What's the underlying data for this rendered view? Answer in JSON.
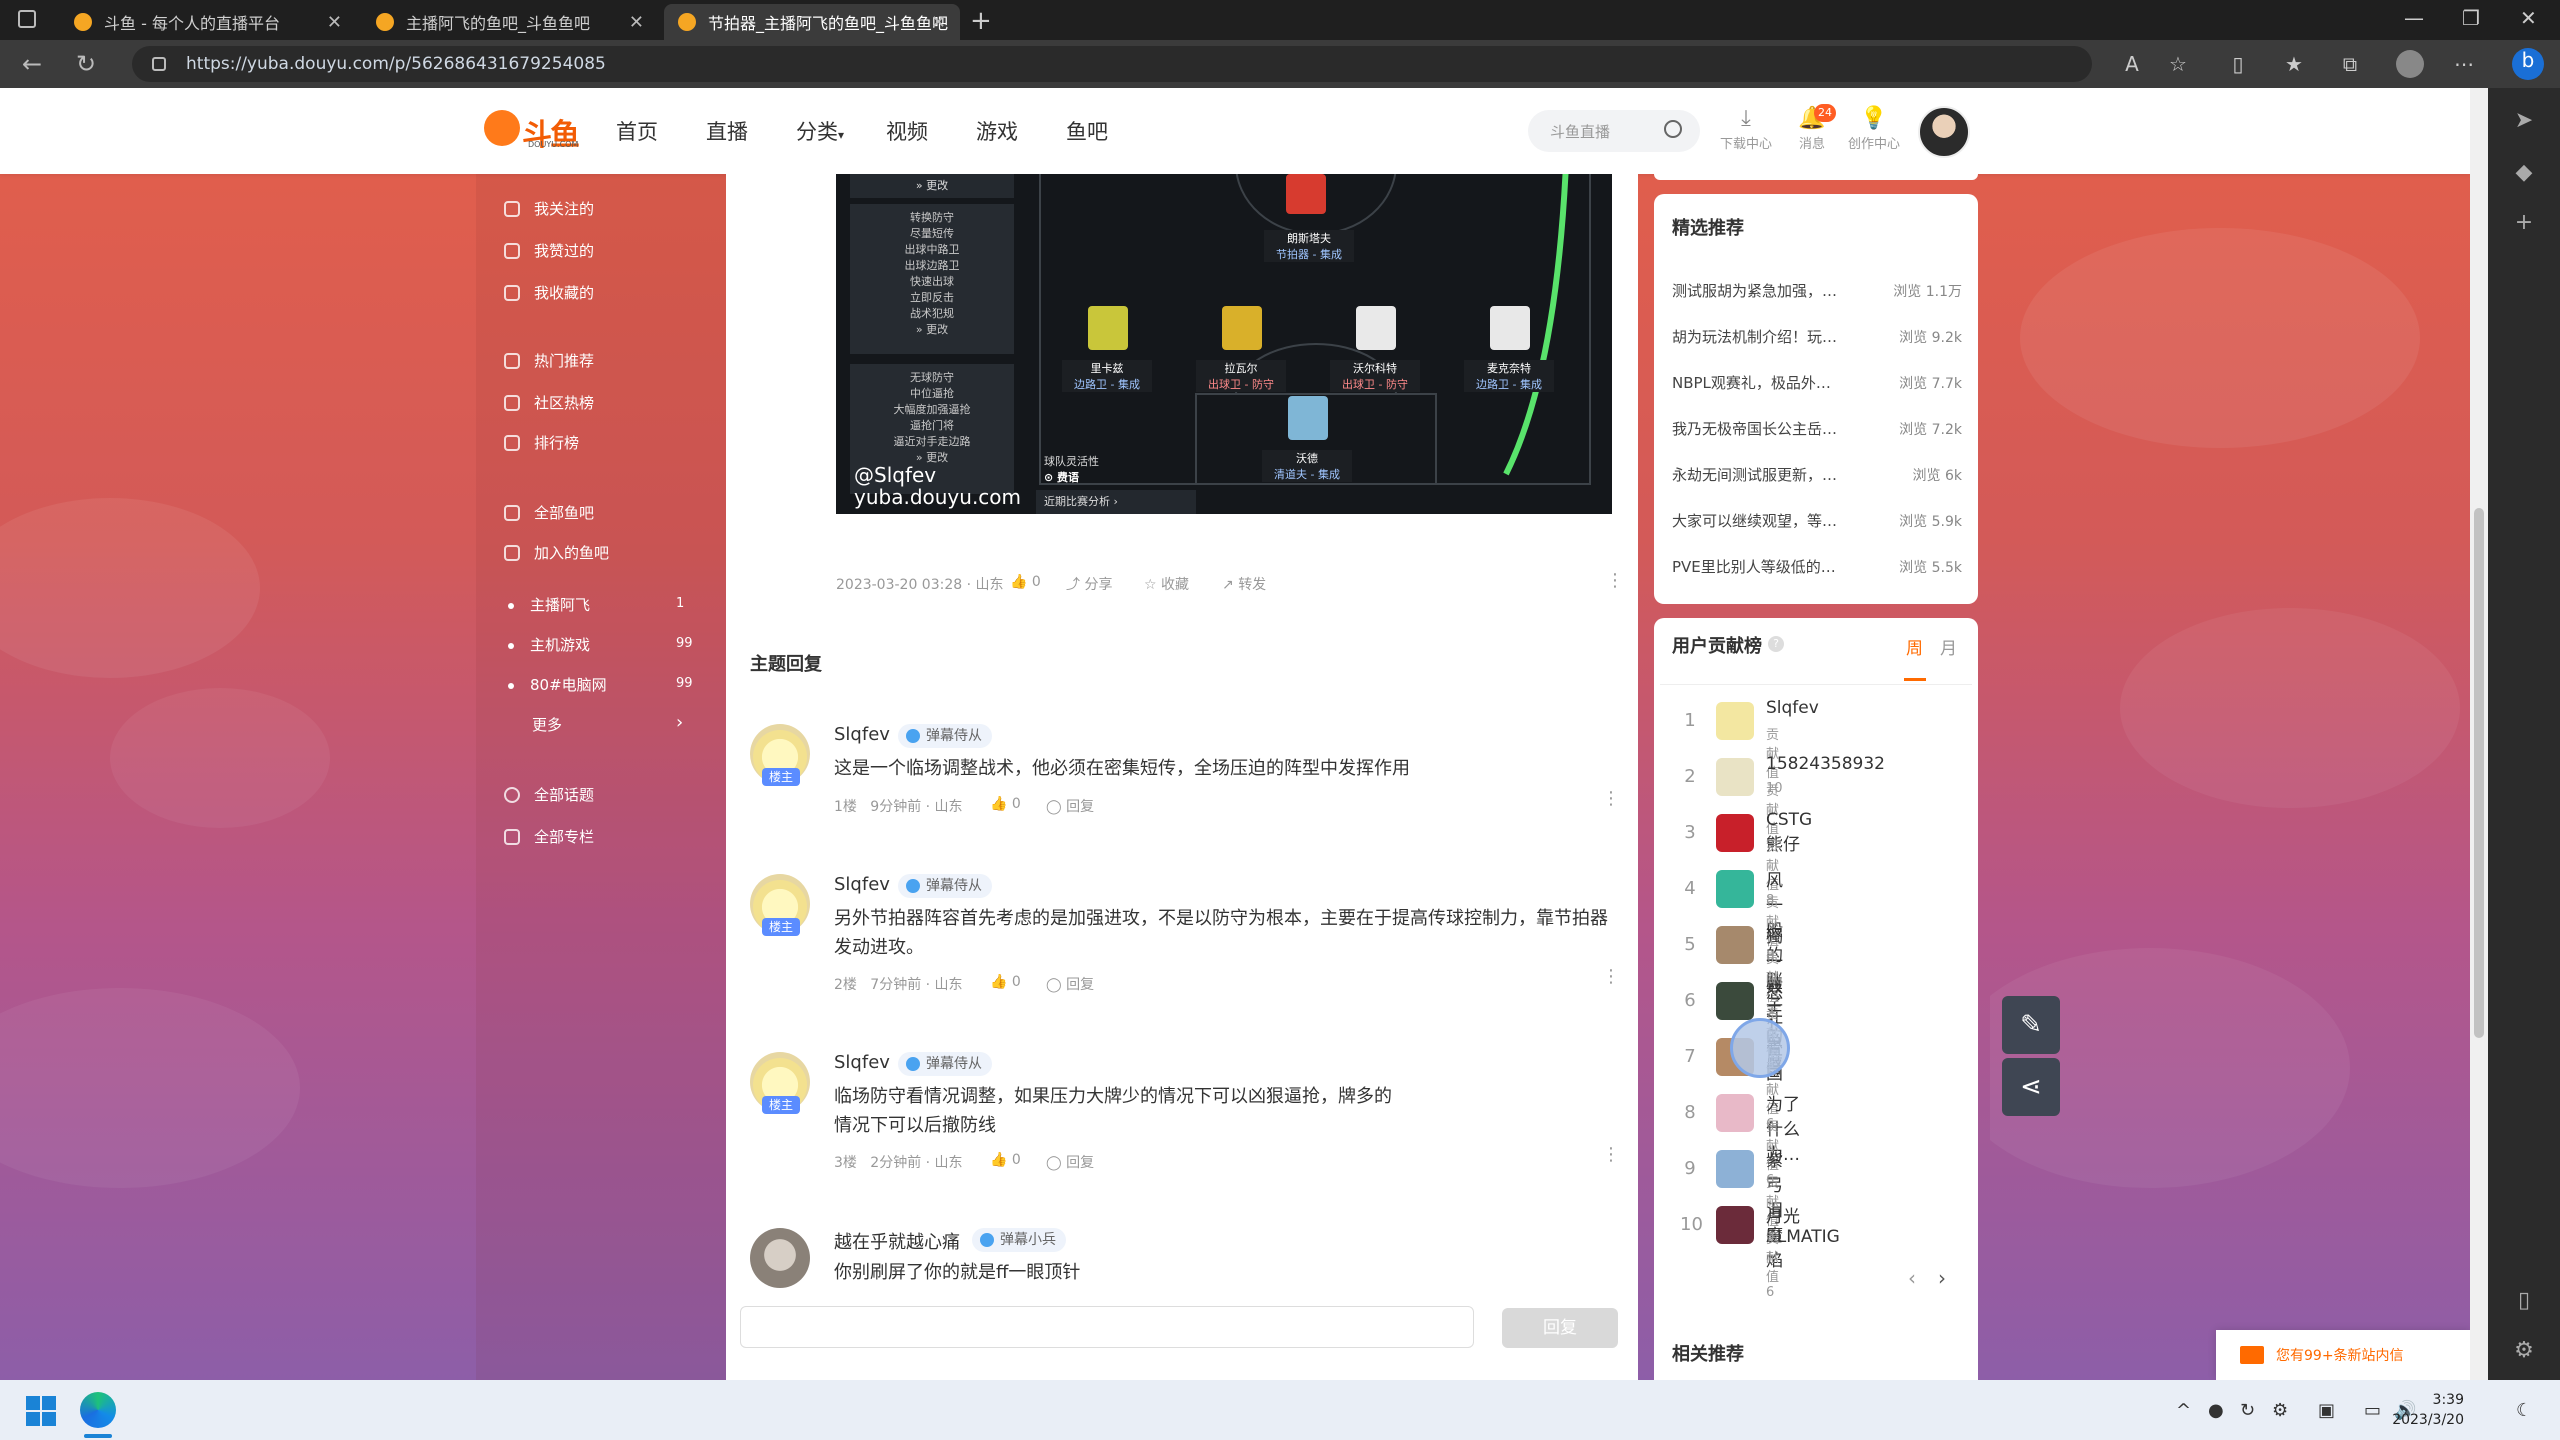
{
  "browser": {
    "tabs": [
      {
        "title": "斗鱼 - 每个人的直播平台",
        "active": false
      },
      {
        "title": "主播阿飞的鱼吧_斗鱼鱼吧",
        "active": false
      },
      {
        "title": "节拍器_主播阿飞的鱼吧_斗鱼鱼吧",
        "active": true
      }
    ],
    "url": "https://yuba.douyu.com/p/562686431679254085"
  },
  "header": {
    "logo_text": "斗鱼",
    "logo_sub": "DOUYU.COM",
    "nav": [
      "首页",
      "直播",
      "分类",
      "视频",
      "游戏",
      "鱼吧"
    ],
    "search_placeholder": "斗鱼直播",
    "icons": [
      {
        "label": "下载中心",
        "icon": "download-icon"
      },
      {
        "label": "消息",
        "icon": "bell-icon",
        "badge": "24"
      },
      {
        "label": "创作中心",
        "icon": "lightbulb-icon"
      }
    ]
  },
  "sidebar": {
    "group1": [
      "我关注的",
      "我赞过的",
      "我收藏的"
    ],
    "group2": [
      "热门推荐",
      "社区热榜",
      "排行榜"
    ],
    "group3": [
      "全部鱼吧",
      "加入的鱼吧"
    ],
    "bars": [
      {
        "name": "主播阿飞",
        "count": "1"
      },
      {
        "name": "主机游戏",
        "count": "99"
      },
      {
        "name": "80#电脑网",
        "count": "99"
      }
    ],
    "more": "更多",
    "group4": [
      "全部话题",
      "全部专栏"
    ]
  },
  "post": {
    "image_watermark_handle": "@Slqfev",
    "image_watermark_site": "yuba.douyu.com",
    "image_left_panels": [
      "转换防守",
      "无球防守"
    ],
    "image_left_items_1": [
      "尽量短传",
      "出球中路卫",
      "出球边路卫",
      "快速出球",
      "立即反击",
      "战术犯规"
    ],
    "image_left_items_2": [
      "中位逼抢",
      "大幅度加强逼抢",
      "逼抢门将",
      "逼近对手走边路"
    ],
    "image_change": "更改",
    "image_players": [
      {
        "name": "朗斯塔夫",
        "role": "节拍器 - 集成"
      },
      {
        "name": "里卡兹",
        "role": "边路卫 - 集成"
      },
      {
        "name": "拉瓦尔",
        "role": "出球卫 - 防守"
      },
      {
        "name": "沃尔科特",
        "role": "出球卫 - 防守"
      },
      {
        "name": "麦克奈特",
        "role": "边路卫 - 集成"
      },
      {
        "name": "沃德",
        "role": "清道夫 - 集成"
      }
    ],
    "image_team_text": "球队灵活性",
    "image_team_value": "费语",
    "image_recent": "近期比赛分析",
    "meta_time": "2023-03-20 03:28 · 山东",
    "like_count": "0",
    "share": "分享",
    "collect": "收藏",
    "forward": "转发"
  },
  "replies": {
    "title": "主题回复",
    "items": [
      {
        "user": "Slqfev",
        "level": "弹幕侍从",
        "tag": "楼主",
        "text": "这是一个临场调整战术，他必须在密集短传，全场压迫的阵型中发挥作用",
        "floor": "1楼",
        "time": "9分钟前 · 山东",
        "likes": "0",
        "reply": "回复"
      },
      {
        "user": "Slqfev",
        "level": "弹幕侍从",
        "tag": "楼主",
        "text": "另外节拍器阵容首先考虑的是加强进攻，不是以防守为根本，主要在于提高传球控制力，靠节拍器发动进攻。",
        "floor": "2楼",
        "time": "7分钟前 · 山东",
        "likes": "0",
        "reply": "回复"
      },
      {
        "user": "Slqfev",
        "level": "弹幕侍从",
        "tag": "楼主",
        "text": "临场防守看情况调整，如果压力大牌少的情况下可以凶狠逼抢，牌多的情况下可以后撤防线",
        "floor": "3楼",
        "time": "2分钟前 · 山东",
        "likes": "0",
        "reply": "回复"
      },
      {
        "user": "越在乎就越心痛",
        "level": "弹幕小兵",
        "tag": "",
        "text": "你别刷屏了你的就是ff一眼顶针",
        "floor": "",
        "time": "",
        "likes": "",
        "reply": ""
      }
    ],
    "reply_button": "回复"
  },
  "featured": {
    "title": "精选推荐",
    "items": [
      {
        "title": "测试服胡为紧急加强，…",
        "views": "浏览 1.1万"
      },
      {
        "title": "胡为玩法机制介绍！玩…",
        "views": "浏览 9.2k"
      },
      {
        "title": "NBPL观赛礼，极品外…",
        "views": "浏览 7.7k"
      },
      {
        "title": "我乃无极帝国长公主岳…",
        "views": "浏览 7.2k"
      },
      {
        "title": "永劫无间测试服更新，…",
        "views": "浏览 6k"
      },
      {
        "title": "大家可以继续观望，等…",
        "views": "浏览 5.9k"
      },
      {
        "title": "PVE里比别人等级低的…",
        "views": "浏览 5.5k"
      }
    ]
  },
  "contrib": {
    "title": "用户贡献榜",
    "tabs": [
      "周",
      "月"
    ],
    "items": [
      {
        "rank": "1",
        "name": "Slqfev",
        "score": "贡献值 10",
        "color": "#f3e7a1"
      },
      {
        "rank": "2",
        "name": "15824358932",
        "score": "贡献值 9",
        "color": "#e9e3c5"
      },
      {
        "rank": "3",
        "name": "CSTG熊仔",
        "score": "贡献值 8",
        "color": "#c8202a"
      },
      {
        "rank": "4",
        "name": "风一般的胖子1",
        "score": "贡献值 8",
        "color": "#35b69a"
      },
      {
        "rank": "5",
        "name": "獨一無二的度",
        "score": "贡献值 7",
        "color": "#a6896c"
      },
      {
        "rank": "6",
        "name": "怒江总督",
        "score": "贡献值 7",
        "color": "#3b4a3c"
      },
      {
        "rank": "7",
        "name": "青国",
        "score": "贡献值 6",
        "color": "#b58a65"
      },
      {
        "rank": "8",
        "name": "为了什么为…",
        "score": "贡献值 6",
        "color": "#e8b9c8"
      },
      {
        "rank": "9",
        "name": "紫弓泪魔焰",
        "score": "贡献值 6",
        "color": "#8db1d6"
      },
      {
        "rank": "10",
        "name": "月光ELMATIG",
        "score": "贡献值 6",
        "color": "#6b2b3a"
      }
    ],
    "pager_prev": "‹",
    "pager_next": "›"
  },
  "related": {
    "title": "相关推荐"
  },
  "notification": {
    "text": "您有99+条新站内信"
  },
  "taskbar": {
    "time": "3:39",
    "date": "2023/3/20"
  }
}
